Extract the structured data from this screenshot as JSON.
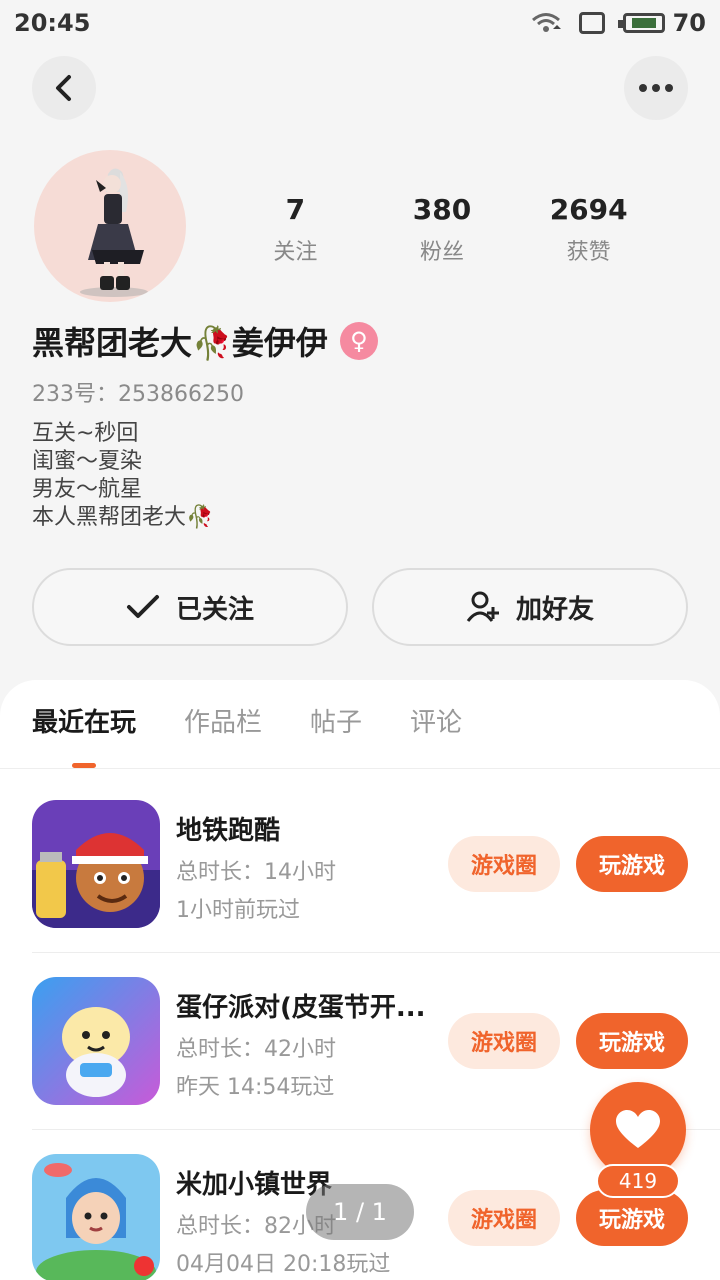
{
  "status": {
    "time": "20:45",
    "battery": "70",
    "icons": [
      "wifi-icon",
      "screen-icon",
      "battery-icon"
    ]
  },
  "nav": {
    "back_icon": "chevron-left-icon",
    "more_icon": "more-dots-icon"
  },
  "profile": {
    "name": "黑帮团老大🥀姜伊伊",
    "gender_icon": "female-icon",
    "uid": "233号：253866250",
    "bio": [
      "互关~秒回",
      "闺蜜～夏染",
      "男友～航星",
      "本人黑帮团老大🥀"
    ],
    "stats": [
      {
        "value": "7",
        "label": "关注"
      },
      {
        "value": "380",
        "label": "粉丝"
      },
      {
        "value": "2694",
        "label": "获赞"
      }
    ]
  },
  "actions": {
    "follow_label": "已关注",
    "friend_label": "加好友"
  },
  "tabs": [
    "最近在玩",
    "作品栏",
    "帖子",
    "评论"
  ],
  "games": [
    {
      "title": "地铁跑酷",
      "duration": "总时长：14小时",
      "last_played": "1小时前玩过",
      "circle": "游戏圈",
      "play": "玩游戏"
    },
    {
      "title": "蛋仔派对(皮蛋节开...",
      "duration": "总时长：42小时",
      "last_played": "昨天 14:54玩过",
      "circle": "游戏圈",
      "play": "玩游戏"
    },
    {
      "title": "米加小镇世界",
      "duration": "总时长：82小时",
      "last_played": "04月04日 20:18玩过",
      "circle": "游戏圈",
      "play": "玩游戏"
    }
  ],
  "like": {
    "count": "419",
    "icon": "heart-icon"
  },
  "pager": "1 / 1",
  "colors": {
    "accent": "#f0642c",
    "accent_light": "#fde9de",
    "gender_pink": "#f58aa0"
  }
}
